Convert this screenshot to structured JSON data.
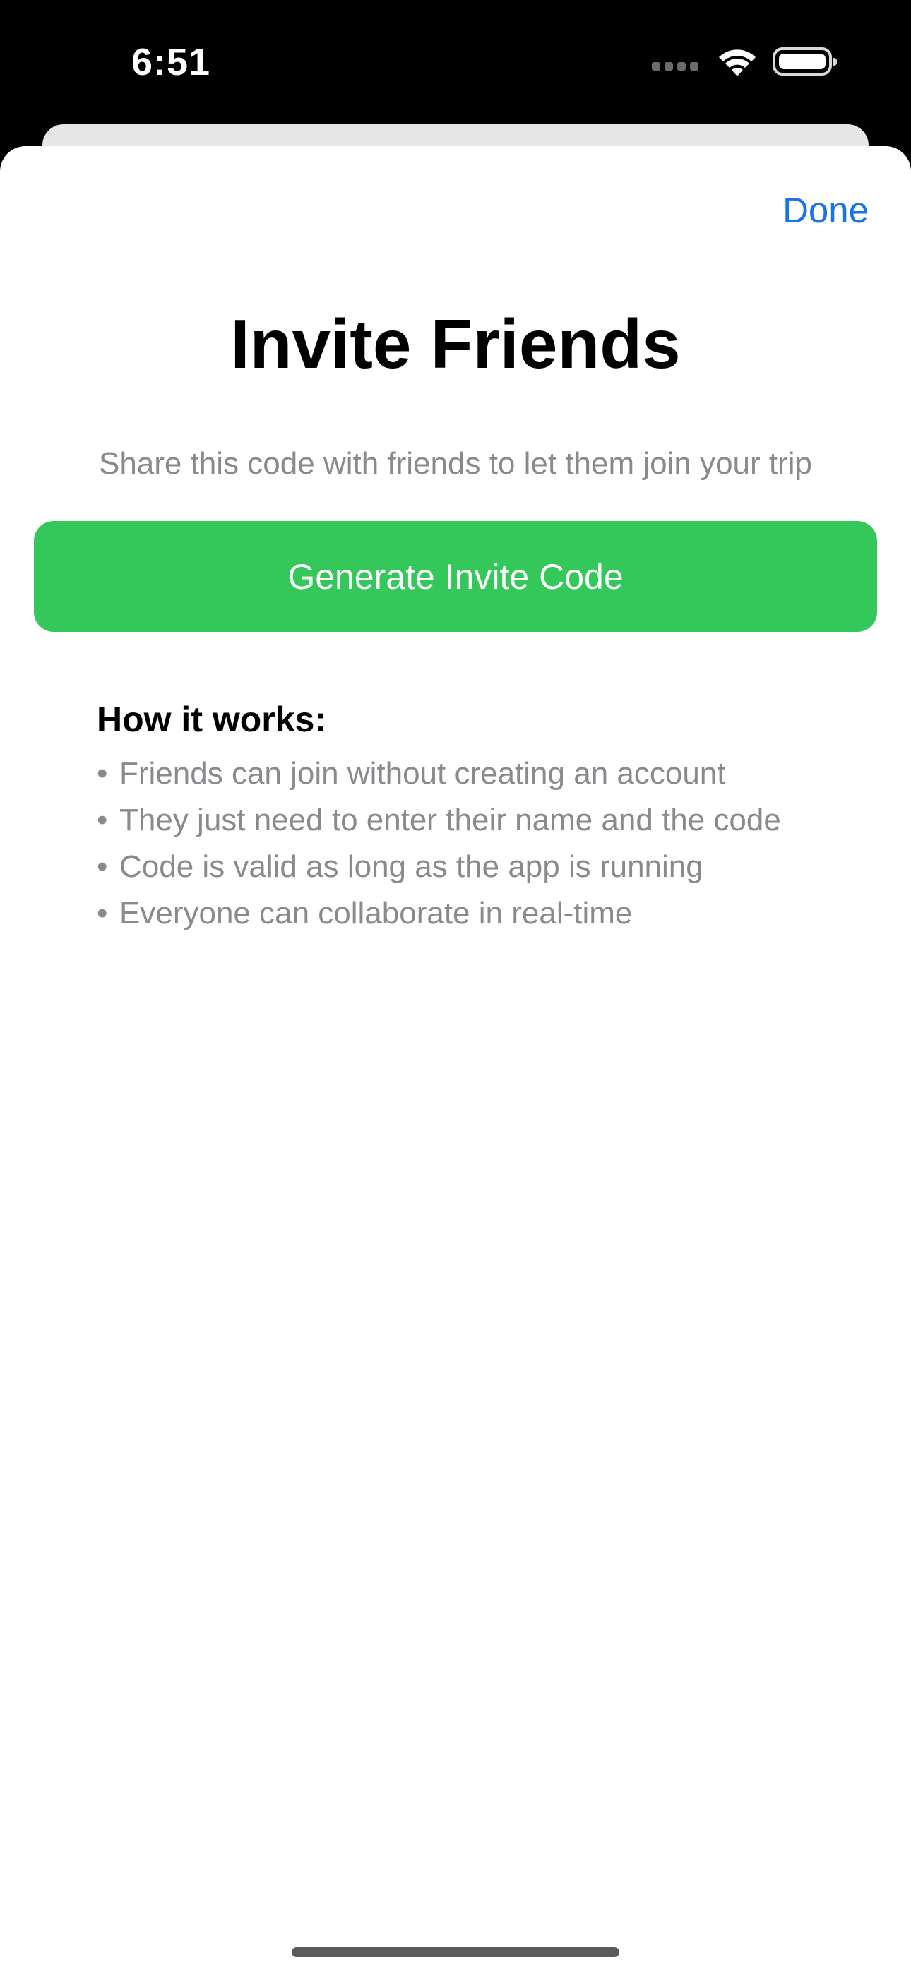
{
  "status_bar": {
    "time": "6:51",
    "icons": [
      "cellular-icon",
      "wifi-icon",
      "battery-icon"
    ]
  },
  "sheet": {
    "done_label": "Done",
    "title": "Invite Friends",
    "subtitle": "Share this code with friends to let them join your trip",
    "generate_button_label": "Generate Invite Code",
    "how_it_works": {
      "heading": "How it works:",
      "bullet": "•",
      "items": [
        "Friends can join without creating an account",
        "They just need to enter their name and the code",
        "Code is valid as long as the app is running",
        "Everyone can collaborate in real-time"
      ]
    }
  },
  "colors": {
    "accent_blue": "#1a73e8",
    "button_green": "#34c759",
    "secondary_text": "#8a8a8e",
    "status_bar_background": "#000000"
  }
}
